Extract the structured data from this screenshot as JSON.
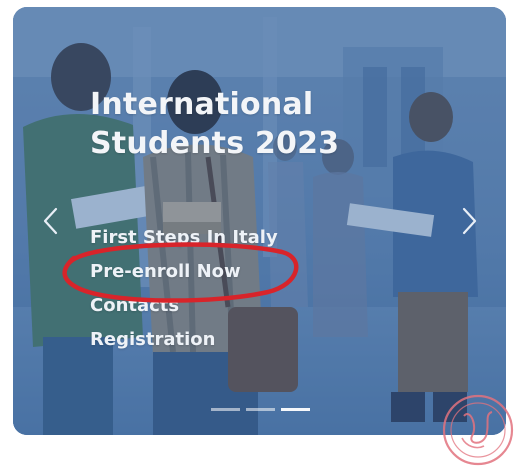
{
  "carousel": {
    "slide": {
      "title": "International\nStudents 2023",
      "links": [
        {
          "label": "First Steps In Italy"
        },
        {
          "label": "Pre-enroll Now"
        },
        {
          "label": "Contacts"
        },
        {
          "label": "Registration"
        }
      ]
    },
    "prev_icon": "chevron-left-icon",
    "next_icon": "chevron-right-icon",
    "indicator_count": 3,
    "active_indicator": 3
  },
  "annotation": {
    "shape": "ellipse",
    "color": "#d8242a",
    "target": "Pre-enroll Now"
  },
  "colors": {
    "overlay": "#2e5c96",
    "text": "#eef2f7",
    "annotation": "#d8242a",
    "stamp": "#e2727e"
  }
}
